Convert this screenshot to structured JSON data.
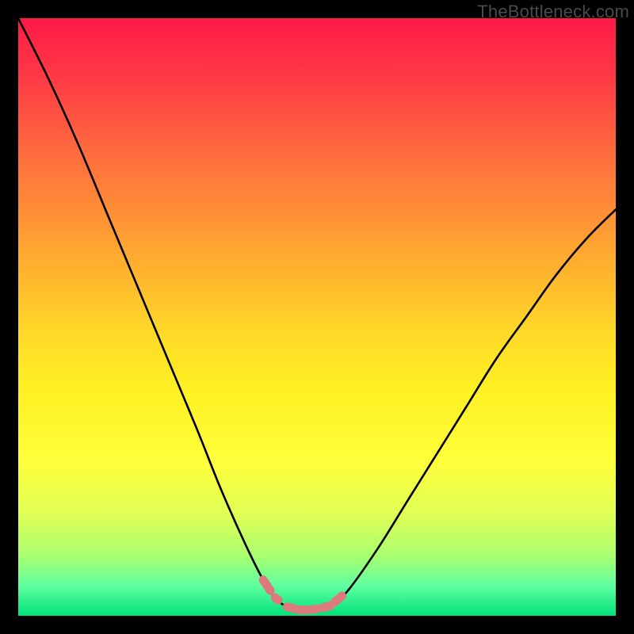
{
  "watermark": "TheBottleneck.com",
  "colors": {
    "frame": "#000000",
    "curve": "#000000",
    "marker": "#dd7a7d"
  },
  "chart_data": {
    "type": "line",
    "title": "",
    "xlabel": "",
    "ylabel": "",
    "xlim": [
      0,
      100
    ],
    "ylim": [
      0,
      100
    ],
    "grid": false,
    "legend": false,
    "x": [
      0,
      5,
      10,
      15,
      20,
      25,
      30,
      34,
      38,
      41,
      43,
      45,
      47,
      49,
      52,
      55,
      60,
      65,
      70,
      75,
      80,
      85,
      90,
      95,
      100
    ],
    "values": [
      100,
      90,
      79,
      67,
      55,
      43,
      31,
      21,
      12,
      6,
      3,
      1.5,
      1,
      1,
      1.5,
      4,
      11,
      19,
      27,
      35,
      43,
      50,
      57,
      63,
      68
    ],
    "annotations": [
      {
        "type": "marker-run",
        "x_start": 41,
        "x_end": 43.5,
        "note": "left descent dashes"
      },
      {
        "type": "marker-run",
        "x_start": 45,
        "x_end": 50,
        "note": "valley bottom dashes"
      },
      {
        "type": "marker-run",
        "x_start": 51,
        "x_end": 55,
        "note": "right ascent dashes"
      }
    ]
  }
}
